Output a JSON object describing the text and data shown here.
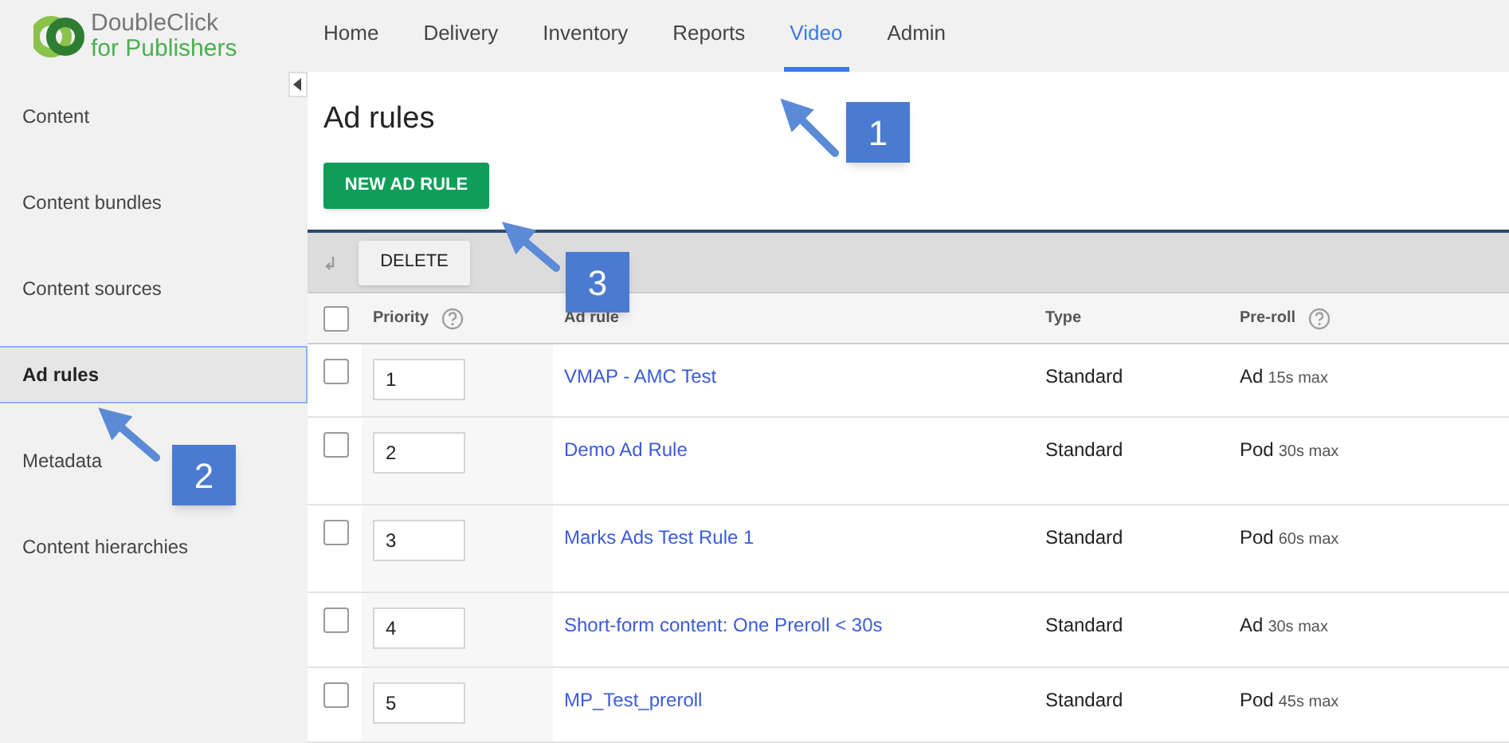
{
  "logo": {
    "line1": "DoubleClick",
    "line2": "for Publishers"
  },
  "nav": [
    {
      "label": "Home",
      "selected": false
    },
    {
      "label": "Delivery",
      "selected": false
    },
    {
      "label": "Inventory",
      "selected": false
    },
    {
      "label": "Reports",
      "selected": false
    },
    {
      "label": "Video",
      "selected": true
    },
    {
      "label": "Admin",
      "selected": false
    }
  ],
  "sidebar": {
    "items": [
      {
        "label": "Content",
        "selected": false
      },
      {
        "label": "Content bundles",
        "selected": false
      },
      {
        "label": "Content sources",
        "selected": false
      },
      {
        "label": "Ad rules",
        "selected": true
      },
      {
        "label": "Metadata",
        "selected": false
      },
      {
        "label": "Content hierarchies",
        "selected": false
      }
    ]
  },
  "page_title": "Ad rules",
  "new_button": "NEW AD RULE",
  "delete_button": "DELETE",
  "table": {
    "select_all": {
      "checked": false
    },
    "columns": [
      {
        "label": "Priority",
        "help": true
      },
      {
        "label": "Ad rule",
        "help": false
      },
      {
        "label": "Type",
        "help": false
      },
      {
        "label": "Pre-roll",
        "help": true
      }
    ],
    "rows": [
      {
        "checked": false,
        "priority": "1",
        "name": "VMAP - AMC Test",
        "type": "Standard",
        "preroll": "Ad",
        "limit": "15s max"
      },
      {
        "checked": false,
        "priority": "2",
        "name": "Demo Ad Rule",
        "type": "Standard",
        "preroll": "Pod",
        "limit": "30s max"
      },
      {
        "checked": false,
        "priority": "3",
        "name": "Marks Ads Test Rule 1",
        "type": "Standard",
        "preroll": "Pod",
        "limit": "60s max"
      },
      {
        "checked": false,
        "priority": "4",
        "name": "Short-form content: One Preroll < 30s",
        "type": "Standard",
        "preroll": "Ad",
        "limit": "30s max"
      },
      {
        "checked": false,
        "priority": "5",
        "name": "MP_Test_preroll",
        "type": "Standard",
        "preroll": "Pod",
        "limit": "45s max"
      }
    ]
  },
  "callouts": [
    "1",
    "2",
    "3"
  ]
}
